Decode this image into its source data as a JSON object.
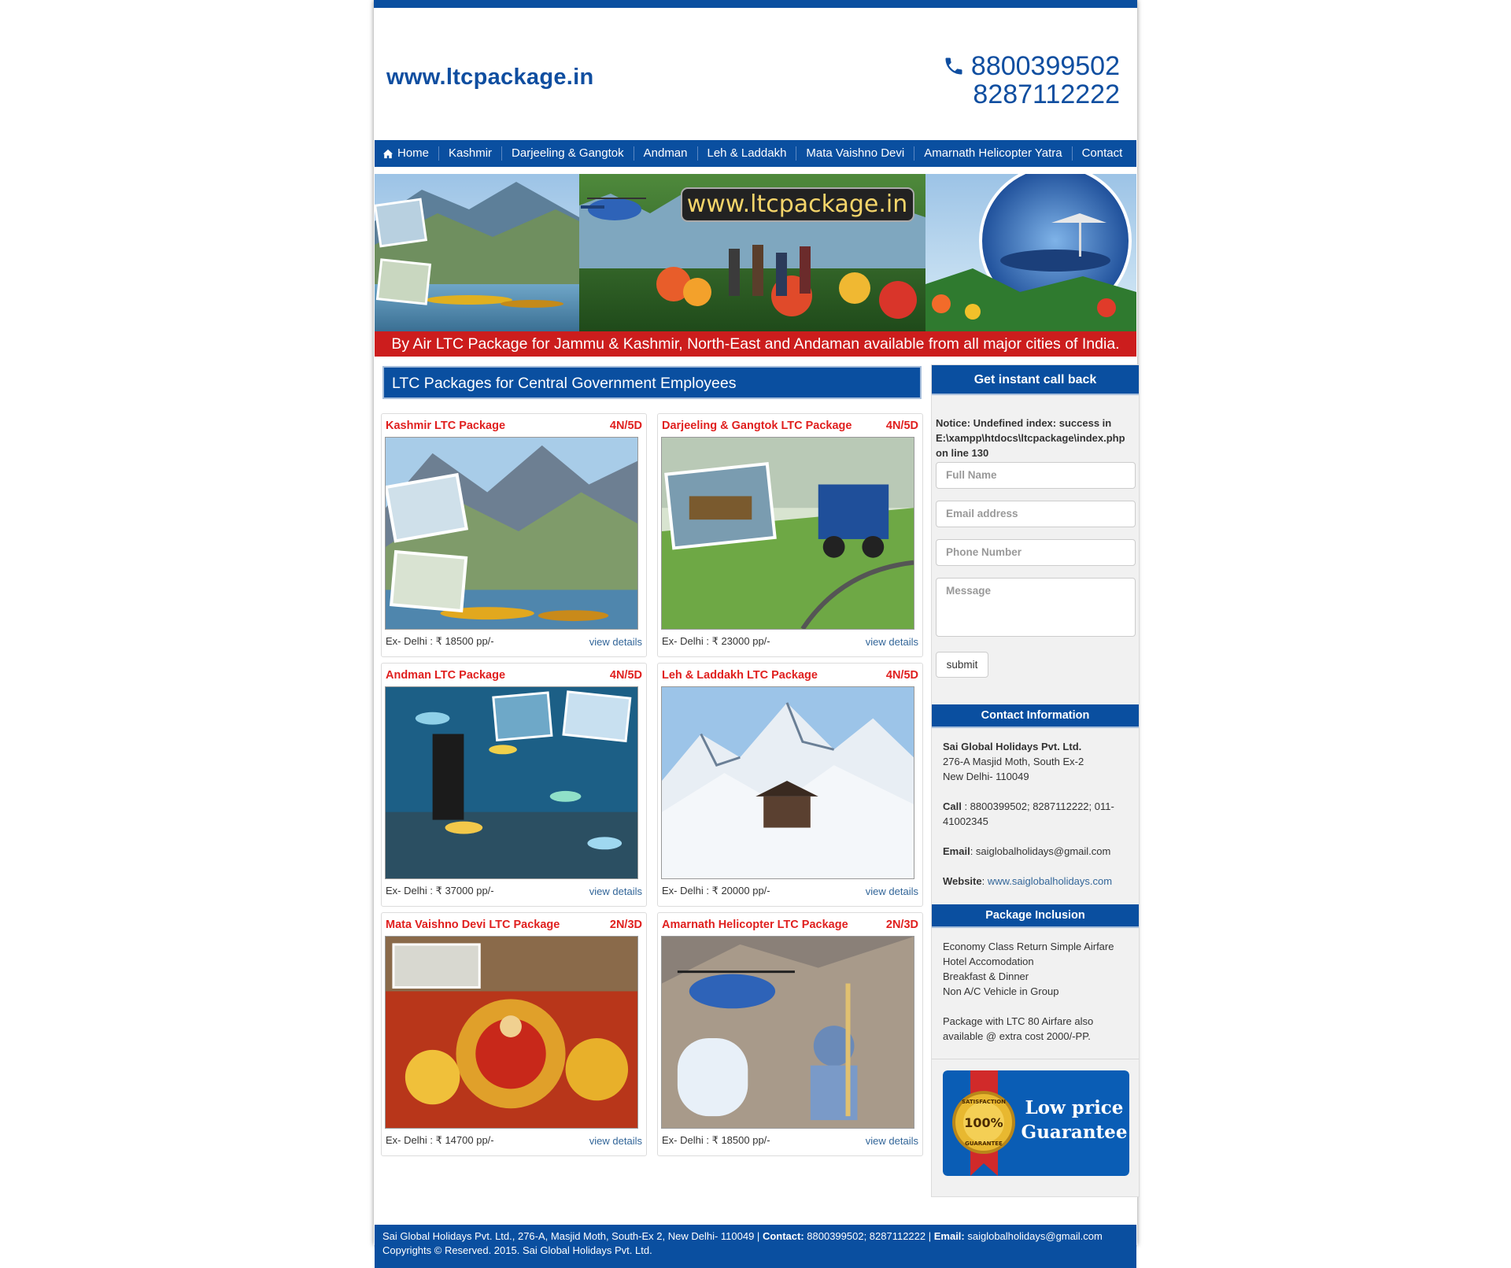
{
  "header": {
    "site_url": "www.ltcpackage.in",
    "phone_1": "8800399502",
    "phone_2": "8287112222"
  },
  "nav": {
    "items": [
      "Home",
      "Kashmir",
      "Darjeeling & Gangtok",
      "Andman",
      "Leh & Laddakh",
      "Mata Vaishno Devi",
      "Amarnath Helicopter Yatra",
      "Contact"
    ]
  },
  "banner": {
    "logo_text": "www.ltcpackage.in",
    "strip_text": "By Air LTC Package for Jammu & Kashmir, North-East and Andaman available from all major cities of India."
  },
  "main": {
    "section_title": "LTC Packages for Central Government Employees",
    "packages": [
      {
        "title": "Kashmir LTC Package",
        "duration": "4N/5D",
        "price": "Ex- Delhi : ₹ 18500 pp/-",
        "link": "view details"
      },
      {
        "title": "Darjeeling & Gangtok LTC Package",
        "duration": "4N/5D",
        "price": "Ex- Delhi : ₹ 23000 pp/-",
        "link": "view details"
      },
      {
        "title": "Andman LTC Package",
        "duration": "4N/5D",
        "price": "Ex- Delhi : ₹ 37000 pp/-",
        "link": "view details"
      },
      {
        "title": "Leh & Laddakh LTC Package",
        "duration": "4N/5D",
        "price": "Ex- Delhi : ₹ 20000 pp/-",
        "link": "view details"
      },
      {
        "title": "Mata Vaishno Devi LTC Package",
        "duration": "2N/3D",
        "price": "Ex- Delhi : ₹ 14700 pp/-",
        "link": "view details"
      },
      {
        "title": "Amarnath Helicopter LTC Package",
        "duration": "2N/3D",
        "price": "Ex- Delhi : ₹ 18500 pp/-",
        "link": "view details"
      }
    ]
  },
  "sidebar": {
    "callback_title": "Get instant call back",
    "notice": "Notice: Undefined index: success in E:\\xampp\\htdocs\\ltcpackage\\index.php on line 130",
    "form": {
      "name_placeholder": "Full Name",
      "email_placeholder": "Email address",
      "phone_placeholder": "Phone Number",
      "message_placeholder": "Message",
      "submit_label": "submit"
    },
    "contact": {
      "title": "Contact Information",
      "company": "Sai Global Holidays Pvt. Ltd.",
      "address_1": "276-A Masjid Moth, South Ex-2",
      "address_2": "New Delhi- 110049",
      "call_label": "Call",
      "call_value": " : 8800399502; 8287112222; 011-41002345",
      "email_label": "Email",
      "email_value": ": saiglobalholidays@gmail.com",
      "website_label": "Website",
      "website_value": "www.saiglobalholidays.com"
    },
    "inclusion": {
      "title": "Package Inclusion",
      "items": [
        "Economy Class Return Simple Airfare",
        "Hotel Accomodation",
        "Breakfast & Dinner",
        "Non A/C Vehicle in Group"
      ],
      "note": "Package with LTC 80 Airfare also available @ extra cost 2000/-PP."
    },
    "guarantee": {
      "seal_top": "SATISFACTION",
      "seal_center": "100%",
      "seal_bottom": "GUARANTEE",
      "line_1": "Low price",
      "line_2": "Guarantee"
    }
  },
  "footer": {
    "line_1_plain": "Sai Global Holidays Pvt. Ltd., 276-A, Masjid Moth, South-Ex 2, New Delhi- 110049 | ",
    "contact_label": "Contact:",
    "contact_value": " 8800399502; 8287112222 | ",
    "email_label": "Email:",
    "email_value": " saiglobalholidays@gmail.com",
    "line_2": "Copyrights © Reserved. 2015. Sai Global Holidays Pvt. Ltd."
  },
  "colors": {
    "brand_blue": "#0a4fa0",
    "banner_red": "#cc1d1d",
    "card_title_red": "#e0201f",
    "link_blue": "#336699"
  }
}
